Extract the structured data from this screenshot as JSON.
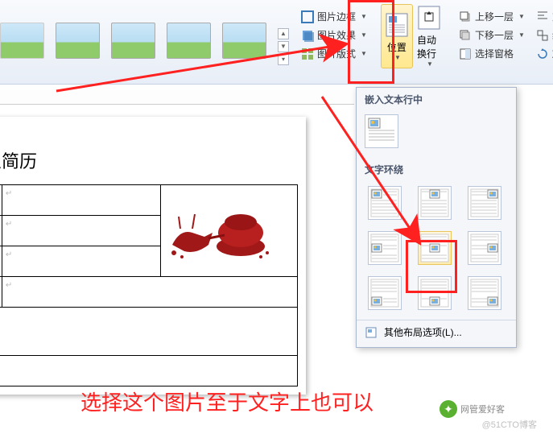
{
  "ribbon": {
    "pic_border": "图片边框",
    "pic_effects": "图片效果",
    "pic_layout": "图片版式",
    "position": "位置",
    "auto_wrap": "自动换行",
    "bring_forward": "上移一层",
    "send_backward": "下移一层",
    "selection_pane": "选择窗格",
    "align": "对",
    "group": "组",
    "rotate": "旋"
  },
  "dropdown": {
    "header1": "嵌入文本行中",
    "header2": "文字环绕",
    "footer": "其他布局选项(L)..."
  },
  "doc": {
    "title": "人简历",
    "para": "↵"
  },
  "annotation": "选择这个图片至于文字上也可以",
  "watermark": {
    "logo_text": "网管爱好客",
    "credit": "@51CTO博客"
  }
}
